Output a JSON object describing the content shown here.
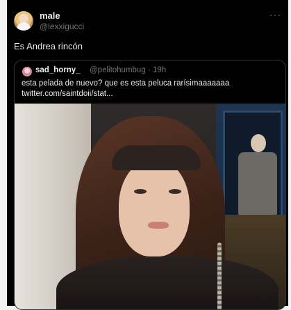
{
  "tweet": {
    "author": {
      "name": "male",
      "handle": "@lexxigucci"
    },
    "more_icon": "more-horizontal-icon",
    "text": "Es Andrea rincón",
    "quote": {
      "author": {
        "name": "sad_horny_",
        "handle": "@pelitohumbug",
        "time": "· 19h"
      },
      "text_line1": "esta pelada de nuevo? que es esta peluca rarísimaaaaaaa",
      "text_line2": "twitter.com/saintdoii/stat..."
    }
  },
  "colors": {
    "background": "#000000",
    "text": "#e7e9ea",
    "muted": "#71767b",
    "border": "#2f3336"
  }
}
